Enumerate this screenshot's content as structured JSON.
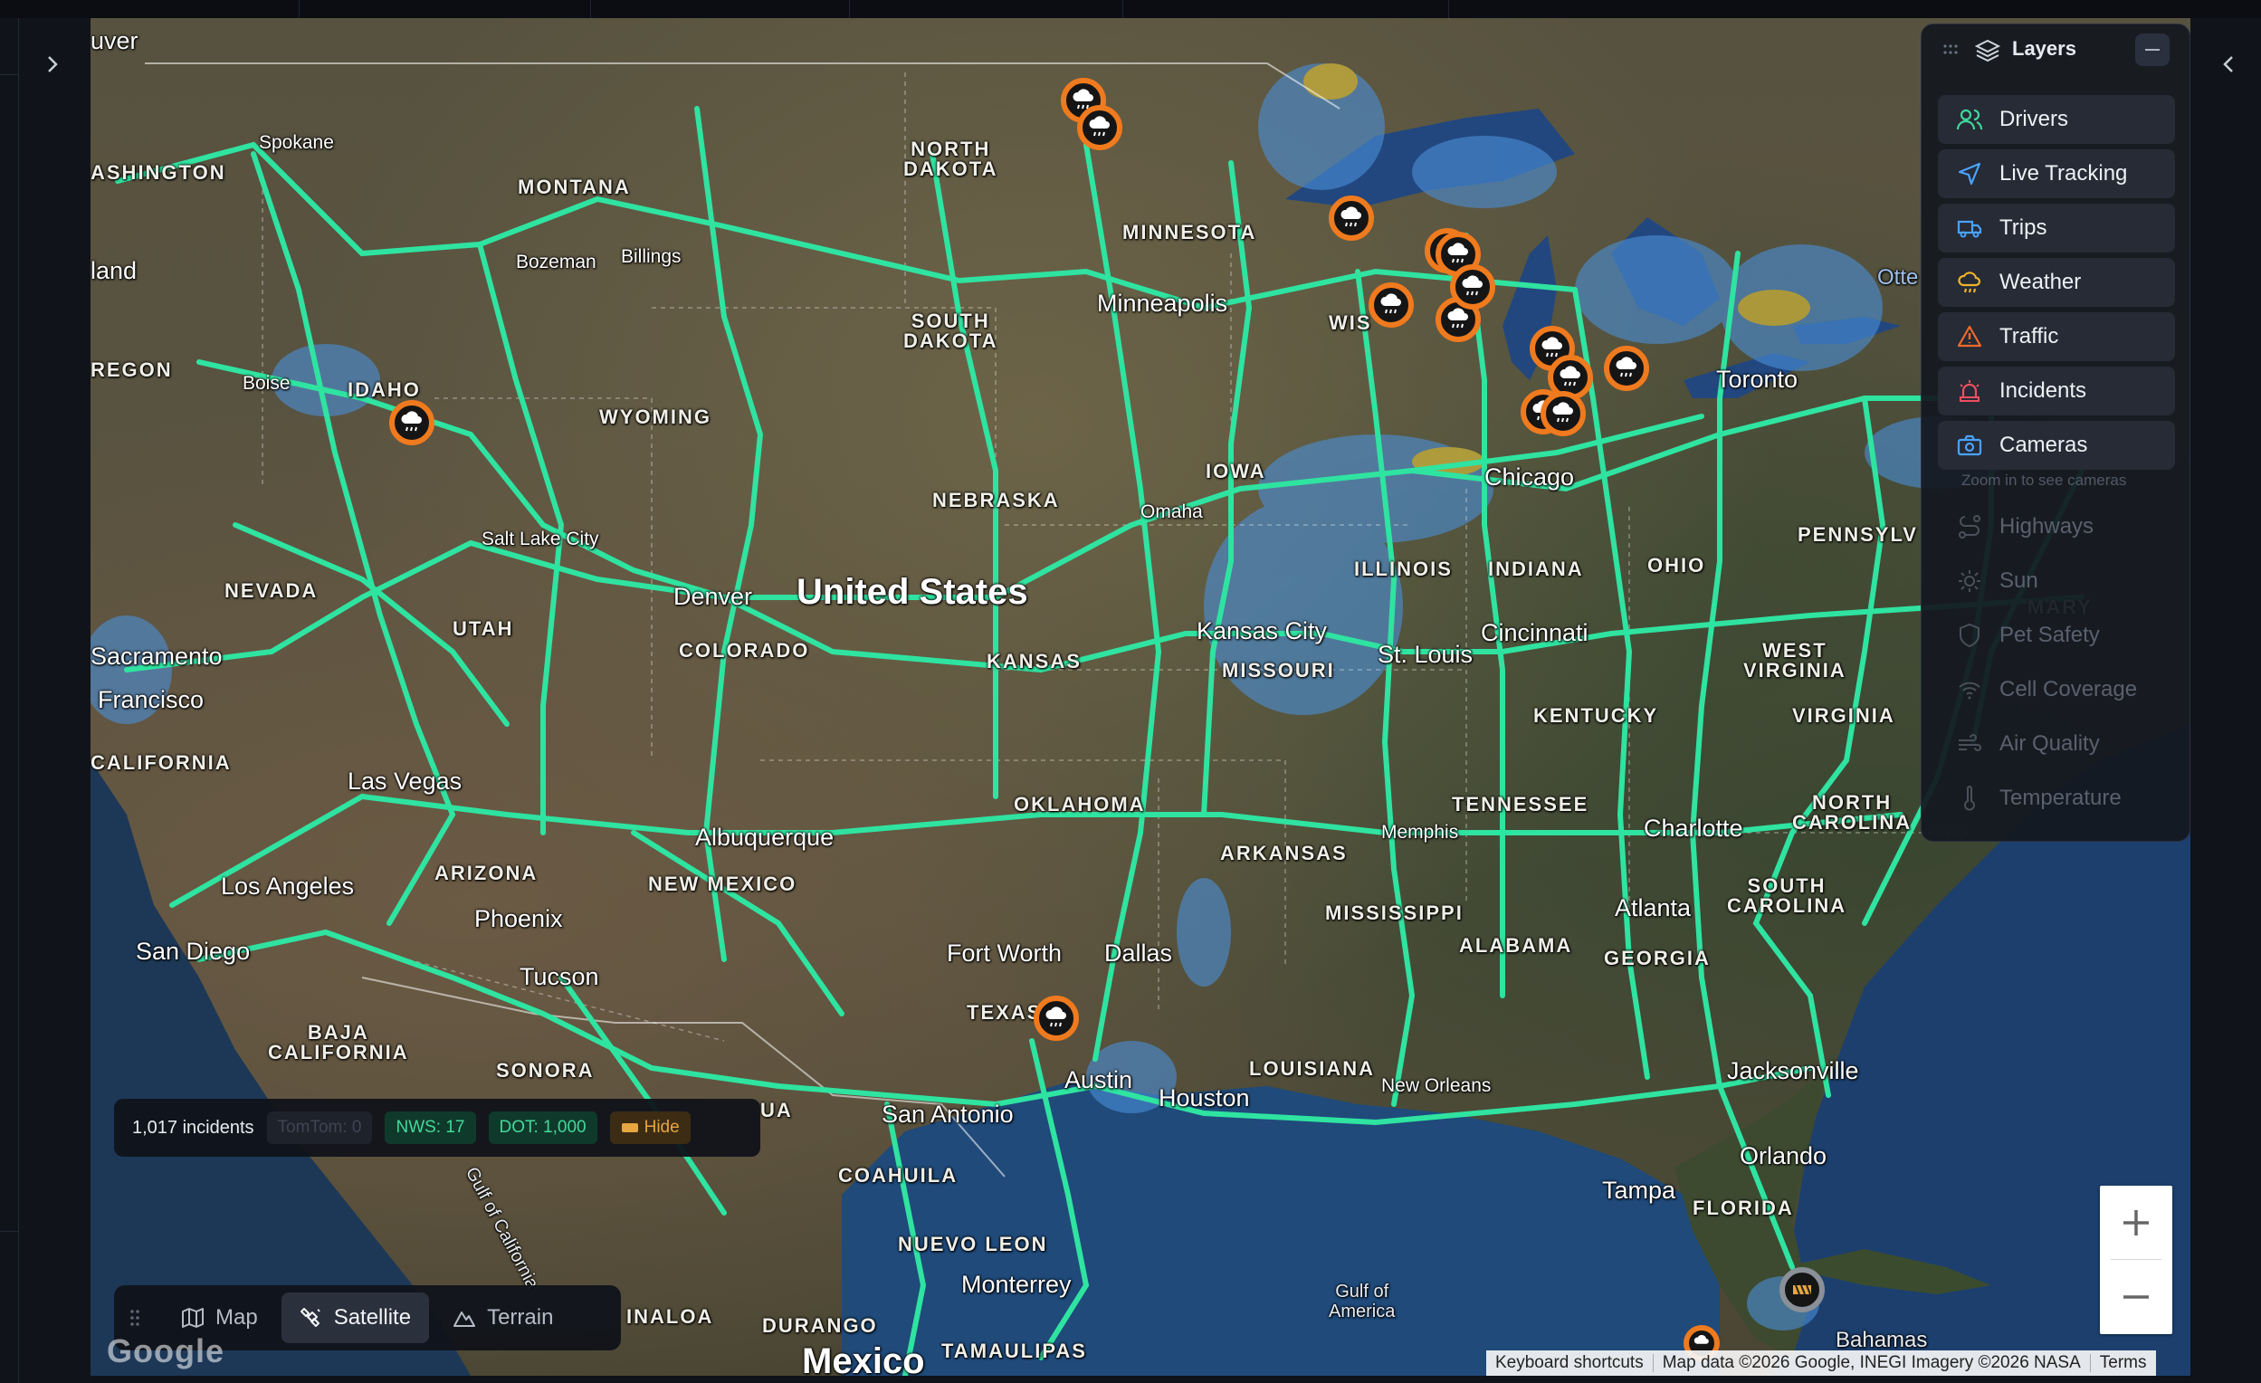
{
  "map": {
    "country_labels": [
      "United States",
      "Mexico"
    ],
    "cities": [
      {
        "name": "Spokane"
      },
      {
        "name": "Bozeman"
      },
      {
        "name": "Billings"
      },
      {
        "name": "Boise"
      },
      {
        "name": "Salt Lake City"
      },
      {
        "name": "Denver"
      },
      {
        "name": "Omaha"
      },
      {
        "name": "Minneapolis"
      },
      {
        "name": "Chicago"
      },
      {
        "name": "Toronto"
      },
      {
        "name": "Kansas City"
      },
      {
        "name": "St. Louis"
      },
      {
        "name": "Cincinnati"
      },
      {
        "name": "Las Vegas"
      },
      {
        "name": "Sacramento"
      },
      {
        "name": "Francisco"
      },
      {
        "name": "Los Angeles"
      },
      {
        "name": "San Diego"
      },
      {
        "name": "Phoenix"
      },
      {
        "name": "Tucson"
      },
      {
        "name": "Albuquerque"
      },
      {
        "name": "Memphis"
      },
      {
        "name": "Charlotte"
      },
      {
        "name": "Atlanta"
      },
      {
        "name": "Fort Worth"
      },
      {
        "name": "Dallas"
      },
      {
        "name": "Austin"
      },
      {
        "name": "San Antonio"
      },
      {
        "name": "Houston"
      },
      {
        "name": "New Orleans"
      },
      {
        "name": "Jacksonville"
      },
      {
        "name": "Orlando"
      },
      {
        "name": "Tampa"
      },
      {
        "name": "Monterrey"
      },
      {
        "name": "uver"
      },
      {
        "name": "land"
      }
    ],
    "states": [
      "ASHINGTON",
      "MONTANA",
      "NORTH\nDAKOTA",
      "MINNESOTA",
      "SOUTH\nDAKOTA",
      "IDAHO",
      "WYOMING",
      "REGON",
      "NEBRASKA",
      "IOWA",
      "NEVADA",
      "UTAH",
      "COLORADO",
      "KANSAS",
      "MISSOURI",
      "ILLINOIS",
      "INDIANA",
      "OHIO",
      "PENNSYLV",
      "WEST\nVIRGINIA",
      "KENTUCKY",
      "VIRGINIA",
      "MARY",
      "CALIFORNIA",
      "OKLAHOMA",
      "TENNESSEE",
      "ARKANSAS",
      "NORTH\nCAROLINA",
      "ARIZONA",
      "NEW MEXICO",
      "MISSISSIPPI",
      "ALABAMA",
      "SOUTH\nCAROLINA",
      "GEORGIA",
      "TEXAS",
      "LOUISIANA",
      "FLORIDA",
      "BAJA\nCALIFORNIA",
      "SONORA",
      "COAHUILA",
      "NUEVO LEON",
      "DURANGO",
      "TAMAULIPAS",
      "INALOA",
      "UA",
      "WIS"
    ],
    "places": [
      "Gulf of\nAmerica",
      "Gulf of California",
      "Bahamas",
      "Otte"
    ]
  },
  "layers_panel": {
    "title": "Layers",
    "items": [
      {
        "label": "Drivers",
        "icon": "users-icon",
        "color": "#3fd79a",
        "enabled": true
      },
      {
        "label": "Live Tracking",
        "icon": "navigation-icon",
        "color": "#4aa3ff",
        "enabled": true
      },
      {
        "label": "Trips",
        "icon": "truck-icon",
        "color": "#4aa3ff",
        "enabled": true
      },
      {
        "label": "Weather",
        "icon": "cloud-rain-icon",
        "color": "#f0b429",
        "enabled": true
      },
      {
        "label": "Traffic",
        "icon": "alert-triangle-icon",
        "color": "#f06a2a",
        "enabled": true
      },
      {
        "label": "Incidents",
        "icon": "siren-icon",
        "color": "#ef4f5f",
        "enabled": true
      },
      {
        "label": "Cameras",
        "icon": "camera-icon",
        "color": "#4aa3ff",
        "enabled": true
      },
      {
        "label": "Highways",
        "icon": "route-icon",
        "color": "#4a4f5a",
        "enabled": false
      },
      {
        "label": "Sun",
        "icon": "sun-icon",
        "color": "#4a4f5a",
        "enabled": false
      },
      {
        "label": "Pet Safety",
        "icon": "shield-icon",
        "color": "#4a4f5a",
        "enabled": false
      },
      {
        "label": "Cell Coverage",
        "icon": "wifi-icon",
        "color": "#4a4f5a",
        "enabled": false
      },
      {
        "label": "Air Quality",
        "icon": "wind-icon",
        "color": "#4a4f5a",
        "enabled": false
      },
      {
        "label": "Temperature",
        "icon": "thermometer-icon",
        "color": "#4a4f5a",
        "enabled": false
      }
    ],
    "cameras_hint": "Zoom in to see cameras"
  },
  "incidents_bar": {
    "count": "1,017 incidents",
    "tomtom": "TomTom: 0",
    "nws": "NWS: 17",
    "dot": "DOT: 1,000",
    "hide": "Hide"
  },
  "map_type": {
    "options": [
      "Map",
      "Satellite",
      "Terrain"
    ],
    "selected": "Satellite"
  },
  "attribution": {
    "keyboard": "Keyboard shortcuts",
    "data": "Map data ©2026 Google, INEGI Imagery ©2026 NASA",
    "terms": "Terms",
    "logo": "Google"
  },
  "colors": {
    "highway": "#2fe3a0",
    "weather_marker_ring": "#f07a1e",
    "radar_blue": "#4a8fd8",
    "radar_yellow": "#e7c93a"
  }
}
